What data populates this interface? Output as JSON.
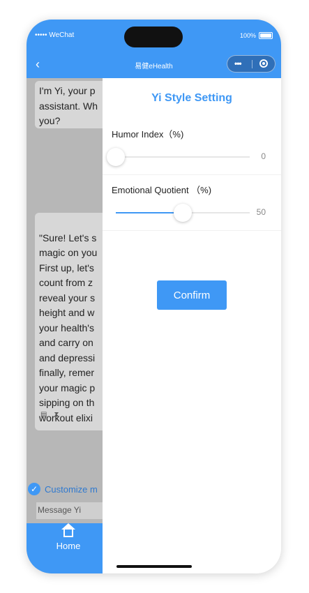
{
  "status_bar": {
    "carrier": "••••• WeChat",
    "battery": "100%"
  },
  "nav": {
    "title": "易健eHealth",
    "back_icon": "chevron-left-icon"
  },
  "chat": {
    "message_1": "I'm Yi, your p\nassistant. Wh\nyou?",
    "message_2": "\"Sure! Let's s\nmagic on you\nFirst up, let's\ncount from z\nreveal your s\nheight and w\nyour health's\nand carry on\nand depressi\nfinally, remer\nyour magic p\nsipping on th\nworkout elixi",
    "customize_label": "Customize m",
    "input_placeholder": "Message Yi"
  },
  "tab_bar": {
    "home_label": "Home"
  },
  "drawer": {
    "title": "Yi Style Setting",
    "humor": {
      "label": "Humor Index（%)",
      "value": 0
    },
    "eq": {
      "label": "Emotional Quotient （%)",
      "value": 50
    },
    "confirm_label": "Confirm"
  },
  "colors": {
    "accent": "#3f98f5",
    "dim_overlay": "#b7b7b7"
  }
}
